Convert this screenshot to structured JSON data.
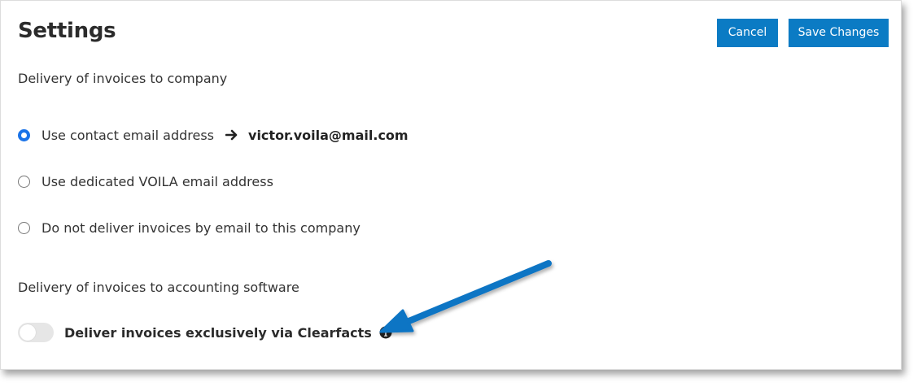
{
  "header": {
    "title": "Settings",
    "cancel_label": "Cancel",
    "save_label": "Save Changes"
  },
  "company_delivery": {
    "section_label": "Delivery of invoices to company",
    "options": [
      {
        "label": "Use contact email address",
        "checked": true,
        "email": "victor.voila@mail.com"
      },
      {
        "label": "Use dedicated VOILA email address",
        "checked": false
      },
      {
        "label": "Do not deliver invoices by email to this company",
        "checked": false
      }
    ]
  },
  "software_delivery": {
    "section_label": "Delivery of invoices to accounting software",
    "toggle_label": "Deliver invoices exclusively via Clearfacts",
    "toggle_on": false
  },
  "icons": {
    "arrow": "arrow-right-icon",
    "info": "info-circle-icon"
  },
  "colors": {
    "accent": "#0b7bc4",
    "radio_checked": "#1a73e8",
    "callout_arrow": "#0e74c4"
  }
}
